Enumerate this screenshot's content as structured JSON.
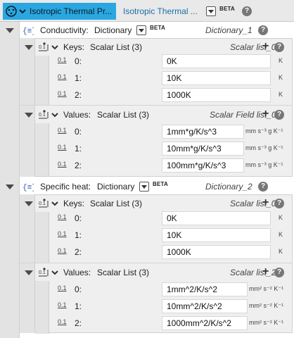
{
  "titlebar": {
    "tab_active": "Isotropic Thermal Pr...",
    "tab_secondary": "Isotropic Thermal ...",
    "beta": "BETA",
    "help": "?"
  },
  "sections": [
    {
      "header": {
        "name": "Conductivity:",
        "type": "Dictionary",
        "beta": "BETA",
        "var": "Dictionary_1"
      },
      "keys": {
        "label": "Keys:",
        "type": "Scalar List (3)",
        "var": "Scalar list_0",
        "rows": [
          {
            "index": "0:",
            "value": "0K",
            "unit": "K"
          },
          {
            "index": "1:",
            "value": "10K",
            "unit": "K"
          },
          {
            "index": "2:",
            "value": "1000K",
            "unit": "K"
          }
        ]
      },
      "values": {
        "label": "Values:",
        "type": "Scalar List (3)",
        "var": "Scalar Field list_0",
        "rows": [
          {
            "index": "0:",
            "value": "1mm*g/K/s^3",
            "unit": "mm s⁻³ g K⁻¹"
          },
          {
            "index": "1:",
            "value": "10mm*g/K/s^3",
            "unit": "mm s⁻³ g K⁻¹"
          },
          {
            "index": "2:",
            "value": "100mm*g/K/s^3",
            "unit": "mm s⁻³ g K⁻¹"
          }
        ]
      }
    },
    {
      "header": {
        "name": "Specific heat:",
        "type": "Dictionary",
        "beta": "BETA",
        "var": "Dictionary_2"
      },
      "keys": {
        "label": "Keys:",
        "type": "Scalar List (3)",
        "var": "Scalar list_0",
        "rows": [
          {
            "index": "0:",
            "value": "0K",
            "unit": "K"
          },
          {
            "index": "1:",
            "value": "10K",
            "unit": "K"
          },
          {
            "index": "2:",
            "value": "1000K",
            "unit": "K"
          }
        ]
      },
      "values": {
        "label": "Values:",
        "type": "Scalar List (3)",
        "var": "Scalar list_2",
        "rows": [
          {
            "index": "0:",
            "value": "1mm^2/K/s^2",
            "unit": "mm² s⁻² K⁻¹"
          },
          {
            "index": "1:",
            "value": "10mm^2/K/s^2",
            "unit": "mm² s⁻² K⁻¹"
          },
          {
            "index": "2:",
            "value": "1000mm^2/K/s^2",
            "unit": "mm² s⁻² K⁻¹"
          }
        ]
      }
    }
  ],
  "scalar_glyph": "0.1",
  "colors": {
    "accent": "#2aa7e0",
    "link": "#1a6fa8",
    "panel": "#efefef"
  },
  "icons": [
    "node-icon",
    "caret-down-icon",
    "dictionary-icon",
    "list-icon",
    "help-icon",
    "plus-icon",
    "dropdown-icon",
    "scalar-icon"
  ]
}
